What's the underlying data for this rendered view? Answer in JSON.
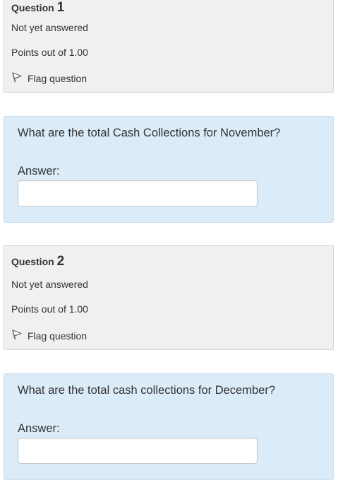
{
  "questions": [
    {
      "label": "Question",
      "number": "1",
      "state": "Not yet answered",
      "grade": "Points out of 1.00",
      "flag_label": "Flag question",
      "flag_icon": "flag-icon",
      "text": "What are the total Cash Collections for November?",
      "answer_label": "Answer:",
      "answer_value": ""
    },
    {
      "label": "Question",
      "number": "2",
      "state": "Not yet answered",
      "grade": "Points out of 1.00",
      "flag_label": "Flag question",
      "flag_icon": "flag-icon",
      "text": "What are the total cash collections for December?",
      "answer_label": "Answer:",
      "answer_value": ""
    }
  ],
  "colors": {
    "info_bg": "#f0f0f0",
    "info_border": "#d4d4d4",
    "formulation_bg": "#dcebf8",
    "formulation_border": "#c7dcef",
    "text": "#333333"
  }
}
